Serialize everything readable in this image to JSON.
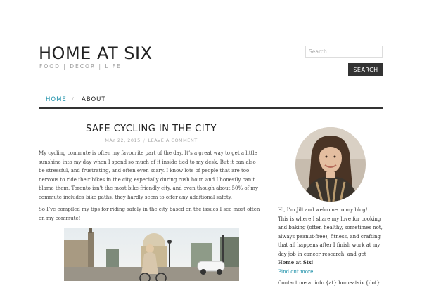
{
  "header": {
    "site_title": "HOME AT SIX",
    "tagline": "FOOD | DECOR | LIFE"
  },
  "search": {
    "placeholder": "Search ...",
    "button_label": "SEARCH"
  },
  "nav": {
    "items": [
      {
        "label": "HOME",
        "active": true
      },
      {
        "label": "ABOUT",
        "active": false
      }
    ],
    "separator": "/",
    "active_color": "#1a8fa8"
  },
  "post": {
    "title": "SAFE CYCLING IN THE CITY",
    "date": "MAY 22, 2015",
    "meta_separator": "/",
    "comment_link": "LEAVE A COMMENT",
    "paragraphs": [
      "My cycling commute is often my favourite part of the day. It’s a great way to get a little sunshine into my day when I spend so much of it inside tied to my desk. But it can also be stressful, and frustrating, and often even scary. I know lots of people that are too nervous to ride their bikes in the city, especially during rush hour, and I honestly can’t blame them. Toronto isn’t the most bike-friendly city, and even though about 50% of my commute includes bike paths, they hardly seem to offer any additional safety.",
      "So I’ve compiled my tips for riding safely in the city based on the issues I see most often on my commute!"
    ]
  },
  "sidebar": {
    "greeting": "Hi, I’m Jill and welcome to my blog!",
    "bio_text": "This is where I share my love for cooking and baking (often healthy, sometimes not, always peanut-free), fitness, and crafting that all happens after I finish work at my day job in cancer research, and get ",
    "bio_bold": "Home at Six",
    "bio_end": "!",
    "find_out_more": "Find out more…",
    "contact": "Contact me at info {at} homeatsix {dot}"
  }
}
